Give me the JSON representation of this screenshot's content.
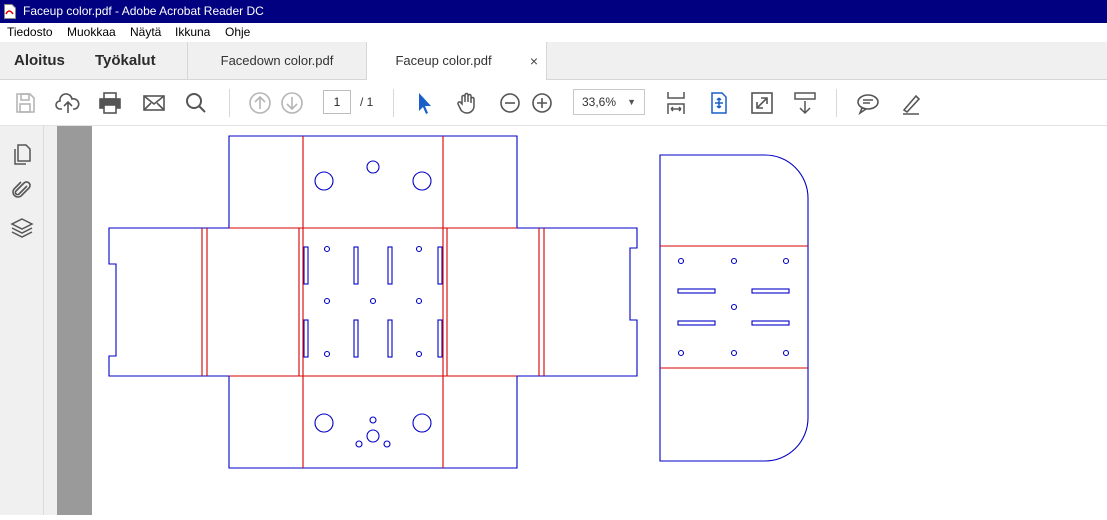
{
  "window": {
    "title": "Faceup color.pdf - Adobe Acrobat Reader DC",
    "title_color": "#000080"
  },
  "menu": {
    "items": [
      "Tiedosto",
      "Muokkaa",
      "Näytä",
      "Ikkuna",
      "Ohje"
    ]
  },
  "tabs": {
    "nav": [
      "Aloitus",
      "Työkalut"
    ],
    "documents": [
      {
        "label": "Facedown color.pdf",
        "active": false
      },
      {
        "label": "Faceup color.pdf",
        "active": true
      }
    ],
    "close_glyph": "×"
  },
  "toolbar": {
    "page_current": "1",
    "page_total": "/ 1",
    "zoom": "33,6%",
    "icons": [
      "save-icon",
      "upload-cloud-icon",
      "print-icon",
      "email-icon",
      "search-icon",
      "previous-page-icon",
      "next-page-icon",
      "select-cursor-icon",
      "hand-pan-icon",
      "zoom-out-icon",
      "zoom-in-icon",
      "fit-page-icon",
      "rotate-scroll-icon",
      "full-screen-icon",
      "read-mode-icon",
      "comment-icon",
      "highlight-pen-icon"
    ]
  },
  "left_rail": {
    "icons": [
      "page-thumbnails-icon",
      "attachments-icon",
      "layers-icon"
    ]
  },
  "document": {
    "line_colors": {
      "cut": "#0000c8",
      "fold": "#d40000"
    }
  }
}
